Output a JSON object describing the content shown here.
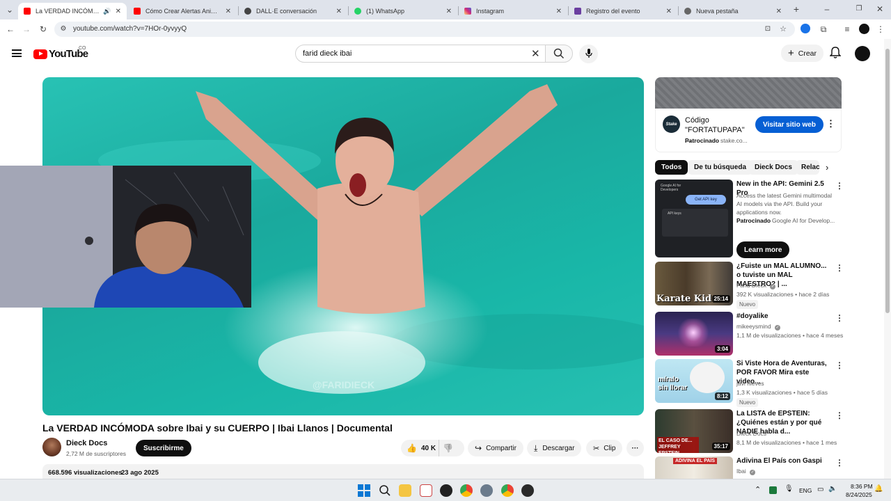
{
  "browser": {
    "tabs": [
      {
        "label": "La VERDAD INCÓMODA sobre Ibai",
        "active": true,
        "color": "#ff0000"
      },
      {
        "label": "Cómo Crear Alertas Animadas P",
        "color": "#ff0000"
      },
      {
        "label": "DALL·E conversación",
        "color": "#444444"
      },
      {
        "label": "(1) WhatsApp",
        "color": "#25d366"
      },
      {
        "label": "Instagram",
        "color": "#d62976"
      },
      {
        "label": "Registro del evento",
        "color": "#6b3fa0"
      },
      {
        "label": "Nueva pestaña",
        "color": "#555555"
      }
    ],
    "url": "youtube.com/watch?v=7HOr-0yvyyQ"
  },
  "header": {
    "logo_text": "YouTube",
    "country_code": "CO",
    "search_value": "farid dieck ibai",
    "create_label": "Crear"
  },
  "video": {
    "watermark": "@FARIDIECK",
    "title": "La VERDAD INCÓMODA sobre Ibai y su CUERPO | Ibai Llanos | Documental",
    "channel": "Dieck Docs",
    "subscribers": "2,72 M de suscriptores",
    "subscribe_label": "Suscribirme",
    "likes": "40 K",
    "share_label": "Compartir",
    "download_label": "Descargar",
    "clip_label": "Clip",
    "views": "668.596 visualizaciones",
    "date": "23 ago 2025"
  },
  "ad": {
    "title": "Código \"FORTATUPAPA\" ...",
    "sponsored": "Patrocinado",
    "domain": "stake.co...",
    "logo_text": "Stake",
    "cta": "Visitar sitio web"
  },
  "chips": [
    "Todos",
    "De tu búsqueda",
    "Dieck Docs",
    "Relacionado"
  ],
  "promo": {
    "title": "New in the API: Gemini 2.5 Pro",
    "description": "Access the latest Gemini multimodal AI models via the API. Build your applications now.",
    "sponsored": "Patrocinado",
    "advertiser": "Google AI for Develop...",
    "cta": "Learn more",
    "thumb_label": "Google AI for Developers",
    "thumb_button": "Get API key",
    "thumb_panel": "API keys"
  },
  "recommendations": [
    {
      "title": "¿Fuiste un MAL ALUMNO... o tuviste un MAL MAESTRO? | ...",
      "channel": "Farid Dieck",
      "meta": "392 K visualizaciones • hace 2 días",
      "duration": "25:14",
      "badge": "Nuevo",
      "thumb_text": "Karate Kid"
    },
    {
      "title": "#doyalike",
      "channel": "mikeeysmind",
      "meta": "1,1 M de visualizaciones • hace 4 meses",
      "duration": "3:04"
    },
    {
      "title": "Si Viste Hora de Aventuras, POR FAVOR Mira este video...",
      "channel": "javi nieves",
      "meta": "1,3 K visualizaciones • hace 5 días",
      "duration": "8:12",
      "badge": "Nuevo",
      "thumb_text": "míralo sin llorar"
    },
    {
      "title": "La LISTA de EPSTEIN: ¿Quiénes están y por qué NADIE habla d...",
      "channel": "Dieck Docs",
      "meta": "8,1 M de visualizaciones • hace 1 mes",
      "duration": "35:17",
      "thumb_text": "EL CASO DE... JEFFREY EPSTEIN"
    },
    {
      "title": "Adivina El País con Gaspi",
      "channel": "Ibai",
      "thumb_text": "ADIVINA EL PAÍS"
    }
  ],
  "taskbar": {
    "language": "ENG",
    "time": "8:36 PM",
    "date": "8/24/2025"
  }
}
